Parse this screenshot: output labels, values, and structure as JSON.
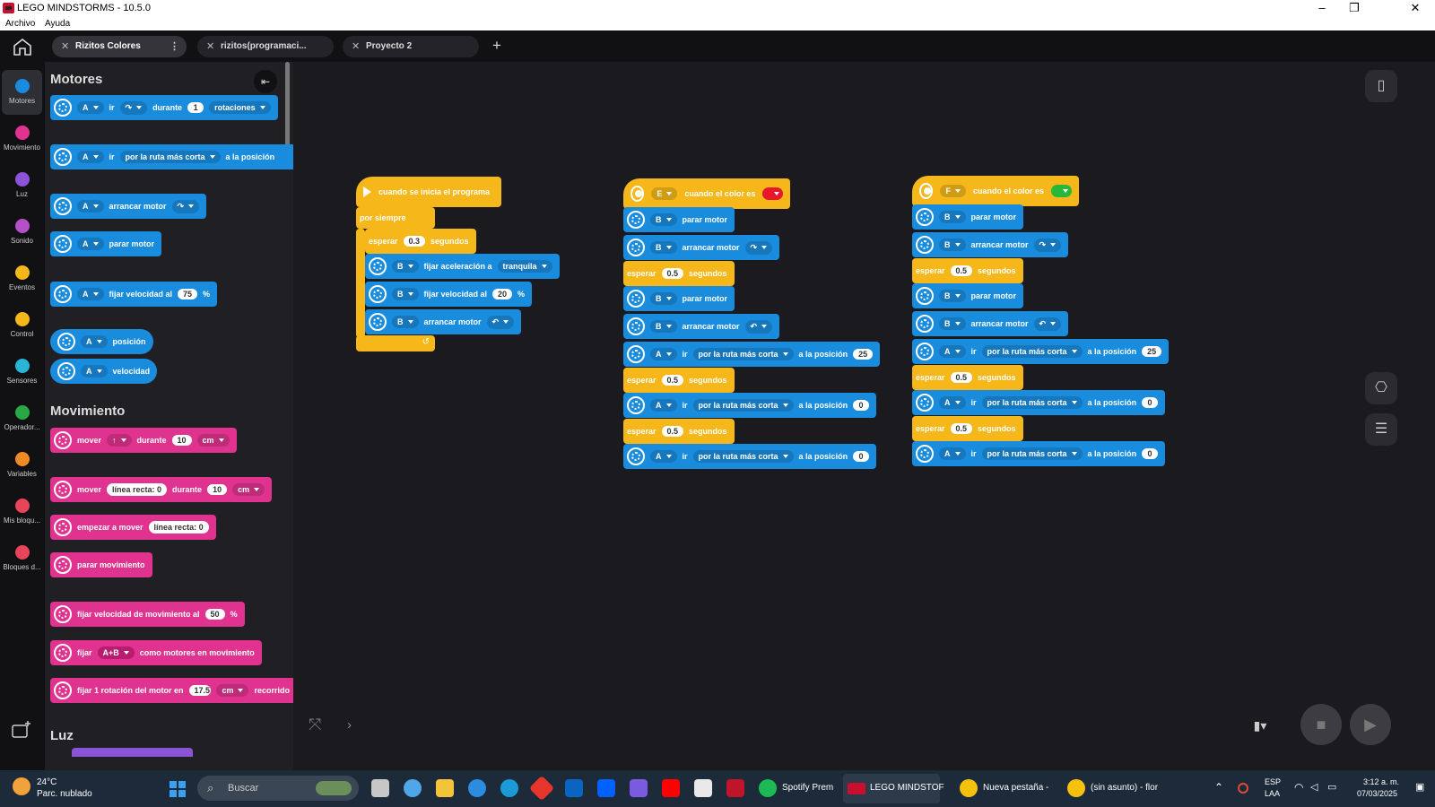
{
  "window": {
    "title": "LEGO MINDSTORMS - 10.5.0",
    "minimize": "–",
    "maximize": "❐",
    "close": "✕"
  },
  "menu": {
    "items": [
      "Archivo",
      "Ayuda"
    ]
  },
  "tabs": [
    {
      "label": "Rizitos Colores",
      "active": true
    },
    {
      "label": "rizitos(programaci..."
    },
    {
      "label": "Proyecto 2"
    }
  ],
  "add_tab": "+",
  "categories": [
    {
      "label": "Motores",
      "color": "#1a8cde"
    },
    {
      "label": "Movimiento",
      "color": "#e0338f"
    },
    {
      "label": "Luz",
      "color": "#8b54d6"
    },
    {
      "label": "Sonido",
      "color": "#b650c8"
    },
    {
      "label": "Eventos",
      "color": "#f5b719"
    },
    {
      "label": "Control",
      "color": "#f5b719"
    },
    {
      "label": "Sensores",
      "color": "#29b6d6"
    },
    {
      "label": "Operador...",
      "color": "#27a844"
    },
    {
      "label": "Variables",
      "color": "#f08a24"
    },
    {
      "label": "Mis bloqu...",
      "color": "#e8445a"
    },
    {
      "label": "Bloques d...",
      "color": "#e8445a"
    }
  ],
  "palette": {
    "motores_title": "Motores",
    "movimiento_title": "Movimiento",
    "luz_title": "Luz",
    "m1": {
      "port": "A",
      "ir": "ir",
      "dir": "↷",
      "durante": "durante",
      "val": "1",
      "unit": "rotaciones"
    },
    "m2": {
      "port": "A",
      "ir": "ir",
      "ruta": "por la ruta más corta",
      "pos": "a la posición"
    },
    "m3": {
      "port": "A",
      "text": "arrancar motor",
      "dir": "↷"
    },
    "m4": {
      "port": "A",
      "text": "parar motor"
    },
    "m5": {
      "port": "A",
      "text": "fijar velocidad al",
      "val": "75",
      "pct": "%"
    },
    "m6": {
      "port": "A",
      "text": "posición"
    },
    "m7": {
      "port": "A",
      "text": "velocidad"
    },
    "v1": {
      "text": "mover",
      "dir": "↑",
      "durante": "durante",
      "val": "10",
      "unit": "cm"
    },
    "v2": {
      "text": "mover",
      "pill": "línea recta: 0",
      "durante": "durante",
      "val": "10",
      "unit": "cm"
    },
    "v3": {
      "text": "empezar a mover",
      "pill": "línea recta: 0"
    },
    "v4": {
      "text": "parar movimiento"
    },
    "v5": {
      "text": "fijar velocidad de movimiento al",
      "val": "50",
      "pct": "%"
    },
    "v6": {
      "text": "fijar",
      "pair": "A+B",
      "rest": "como motores en movimiento"
    },
    "v7": {
      "text": "fijar 1 rotación del motor en",
      "val": "17.5",
      "unit": "cm",
      "rest": "recorrido"
    }
  },
  "program1": {
    "start": "cuando se inicia el programa",
    "forever": "por siempre",
    "wait": "esperar",
    "wait_val": "0.3",
    "seconds": "segundos",
    "b1": {
      "port": "B",
      "text": "fijar aceleración a",
      "opt": "tranquila"
    },
    "b2": {
      "port": "B",
      "text": "fijar velocidad al",
      "val": "20",
      "pct": "%"
    },
    "b3": {
      "port": "B",
      "text": "arrancar motor",
      "dir": "↶"
    },
    "loop": "↺"
  },
  "program2": {
    "hat_port": "E",
    "hat_text": "cuando el color es",
    "hat_color": "#e8172b",
    "stop_port": "B",
    "stop": "parar motor",
    "run_port": "B",
    "run": "arrancar motor",
    "run_dir": "↷",
    "wait": "esperar",
    "wait_val": "0.5",
    "seconds": "segundos",
    "stop2": "parar motor",
    "run2": "arrancar motor",
    "run2_dir": "↶",
    "go_port": "A",
    "go": "ir",
    "ruta": "por la ruta más corta",
    "pos": "a la posición",
    "pos1": "25",
    "wait2": "0.5",
    "pos2": "0",
    "wait3": "0.5",
    "pos3": "0"
  },
  "program3": {
    "hat_port": "F",
    "hat_text": "cuando el color es",
    "hat_color": "#27b83a",
    "stop_port": "B",
    "stop": "parar motor",
    "run_port": "B",
    "run": "arrancar motor",
    "run_dir": "↷",
    "wait": "esperar",
    "wait_val": "0.5",
    "seconds": "segundos",
    "stop2": "parar motor",
    "run2": "arrancar motor",
    "run2_dir": "↶",
    "go_port": "A",
    "go": "ir",
    "ruta": "por la ruta más corta",
    "pos": "a la posición",
    "pos1": "25",
    "wait2": "0.5",
    "pos2": "0",
    "wait3": "0.5",
    "pos3": "0"
  },
  "taskbar": {
    "weather_temp": "24°C",
    "weather_desc": "Parc. nublado",
    "search": "Buscar",
    "spotify": "Spotify Prem",
    "lego": "LEGO MINDSTOF",
    "chrome1": "Nueva pestaña -",
    "chrome2": "(sin asunto) - flor",
    "lang1": "ESP",
    "lang2": "LAA",
    "time": "3:12 a. m.",
    "date": "07/03/2025"
  }
}
